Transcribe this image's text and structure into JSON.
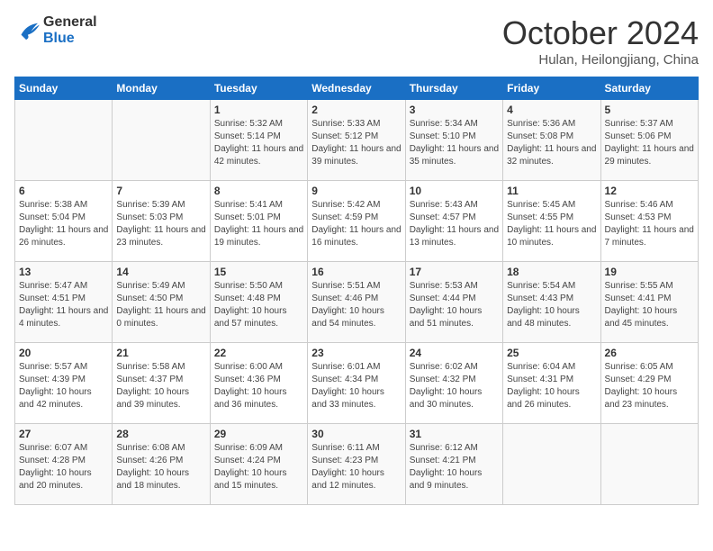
{
  "logo": {
    "line1": "General",
    "line2": "Blue"
  },
  "title": "October 2024",
  "subtitle": "Hulan, Heilongjiang, China",
  "weekdays": [
    "Sunday",
    "Monday",
    "Tuesday",
    "Wednesday",
    "Thursday",
    "Friday",
    "Saturday"
  ],
  "weeks": [
    [
      {
        "date": "",
        "info": ""
      },
      {
        "date": "",
        "info": ""
      },
      {
        "date": "1",
        "info": "Sunrise: 5:32 AM\nSunset: 5:14 PM\nDaylight: 11 hours and 42 minutes."
      },
      {
        "date": "2",
        "info": "Sunrise: 5:33 AM\nSunset: 5:12 PM\nDaylight: 11 hours and 39 minutes."
      },
      {
        "date": "3",
        "info": "Sunrise: 5:34 AM\nSunset: 5:10 PM\nDaylight: 11 hours and 35 minutes."
      },
      {
        "date": "4",
        "info": "Sunrise: 5:36 AM\nSunset: 5:08 PM\nDaylight: 11 hours and 32 minutes."
      },
      {
        "date": "5",
        "info": "Sunrise: 5:37 AM\nSunset: 5:06 PM\nDaylight: 11 hours and 29 minutes."
      }
    ],
    [
      {
        "date": "6",
        "info": "Sunrise: 5:38 AM\nSunset: 5:04 PM\nDaylight: 11 hours and 26 minutes."
      },
      {
        "date": "7",
        "info": "Sunrise: 5:39 AM\nSunset: 5:03 PM\nDaylight: 11 hours and 23 minutes."
      },
      {
        "date": "8",
        "info": "Sunrise: 5:41 AM\nSunset: 5:01 PM\nDaylight: 11 hours and 19 minutes."
      },
      {
        "date": "9",
        "info": "Sunrise: 5:42 AM\nSunset: 4:59 PM\nDaylight: 11 hours and 16 minutes."
      },
      {
        "date": "10",
        "info": "Sunrise: 5:43 AM\nSunset: 4:57 PM\nDaylight: 11 hours and 13 minutes."
      },
      {
        "date": "11",
        "info": "Sunrise: 5:45 AM\nSunset: 4:55 PM\nDaylight: 11 hours and 10 minutes."
      },
      {
        "date": "12",
        "info": "Sunrise: 5:46 AM\nSunset: 4:53 PM\nDaylight: 11 hours and 7 minutes."
      }
    ],
    [
      {
        "date": "13",
        "info": "Sunrise: 5:47 AM\nSunset: 4:51 PM\nDaylight: 11 hours and 4 minutes."
      },
      {
        "date": "14",
        "info": "Sunrise: 5:49 AM\nSunset: 4:50 PM\nDaylight: 11 hours and 0 minutes."
      },
      {
        "date": "15",
        "info": "Sunrise: 5:50 AM\nSunset: 4:48 PM\nDaylight: 10 hours and 57 minutes."
      },
      {
        "date": "16",
        "info": "Sunrise: 5:51 AM\nSunset: 4:46 PM\nDaylight: 10 hours and 54 minutes."
      },
      {
        "date": "17",
        "info": "Sunrise: 5:53 AM\nSunset: 4:44 PM\nDaylight: 10 hours and 51 minutes."
      },
      {
        "date": "18",
        "info": "Sunrise: 5:54 AM\nSunset: 4:43 PM\nDaylight: 10 hours and 48 minutes."
      },
      {
        "date": "19",
        "info": "Sunrise: 5:55 AM\nSunset: 4:41 PM\nDaylight: 10 hours and 45 minutes."
      }
    ],
    [
      {
        "date": "20",
        "info": "Sunrise: 5:57 AM\nSunset: 4:39 PM\nDaylight: 10 hours and 42 minutes."
      },
      {
        "date": "21",
        "info": "Sunrise: 5:58 AM\nSunset: 4:37 PM\nDaylight: 10 hours and 39 minutes."
      },
      {
        "date": "22",
        "info": "Sunrise: 6:00 AM\nSunset: 4:36 PM\nDaylight: 10 hours and 36 minutes."
      },
      {
        "date": "23",
        "info": "Sunrise: 6:01 AM\nSunset: 4:34 PM\nDaylight: 10 hours and 33 minutes."
      },
      {
        "date": "24",
        "info": "Sunrise: 6:02 AM\nSunset: 4:32 PM\nDaylight: 10 hours and 30 minutes."
      },
      {
        "date": "25",
        "info": "Sunrise: 6:04 AM\nSunset: 4:31 PM\nDaylight: 10 hours and 26 minutes."
      },
      {
        "date": "26",
        "info": "Sunrise: 6:05 AM\nSunset: 4:29 PM\nDaylight: 10 hours and 23 minutes."
      }
    ],
    [
      {
        "date": "27",
        "info": "Sunrise: 6:07 AM\nSunset: 4:28 PM\nDaylight: 10 hours and 20 minutes."
      },
      {
        "date": "28",
        "info": "Sunrise: 6:08 AM\nSunset: 4:26 PM\nDaylight: 10 hours and 18 minutes."
      },
      {
        "date": "29",
        "info": "Sunrise: 6:09 AM\nSunset: 4:24 PM\nDaylight: 10 hours and 15 minutes."
      },
      {
        "date": "30",
        "info": "Sunrise: 6:11 AM\nSunset: 4:23 PM\nDaylight: 10 hours and 12 minutes."
      },
      {
        "date": "31",
        "info": "Sunrise: 6:12 AM\nSunset: 4:21 PM\nDaylight: 10 hours and 9 minutes."
      },
      {
        "date": "",
        "info": ""
      },
      {
        "date": "",
        "info": ""
      }
    ]
  ]
}
